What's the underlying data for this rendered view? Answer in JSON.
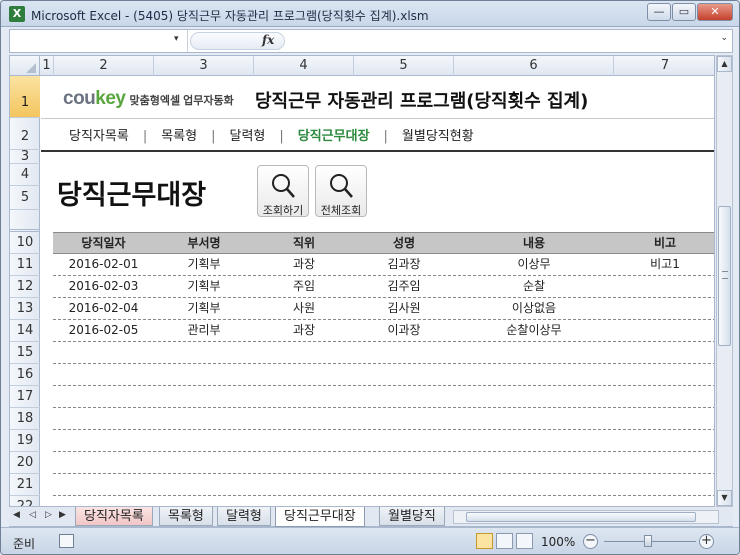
{
  "window": {
    "title": "Microsoft Excel - (5405) 당직근무 자동관리 프로그램(당직횟수 집계).xlsm",
    "app_icon": "X",
    "min_label": "—",
    "restore_label": "▭",
    "close_label": "✕"
  },
  "formula_bar": {
    "fx_label": "fx",
    "name_arrow": "▾",
    "expand_arrow": "⌄"
  },
  "columns": [
    "1",
    "2",
    "3",
    "4",
    "5",
    "6",
    "7"
  ],
  "rows": [
    "1",
    "2",
    "3",
    "4",
    "5",
    "10",
    "11",
    "12",
    "13",
    "14",
    "15",
    "16",
    "17",
    "18",
    "19",
    "20",
    "21",
    "22"
  ],
  "header": {
    "logo_main_1": "cou",
    "logo_main_2": "key",
    "logo_sub": "맞춤형엑셀 업무자동화",
    "app_title": "당직근무 자동관리 프로그램(당직횟수 집계)"
  },
  "nav": {
    "items": [
      "당직자목록",
      "목록형",
      "달력형",
      "당직근무대장",
      "월별당직현황"
    ],
    "separator": "|",
    "active_index": 3
  },
  "page_title": "당직근무대장",
  "buttons": {
    "search_label": "조회하기",
    "search_all_label": "전체조회"
  },
  "table": {
    "headers": [
      "당직일자",
      "부서명",
      "직위",
      "성명",
      "내용",
      "비고"
    ],
    "rows": [
      [
        "2016-02-01",
        "기획부",
        "과장",
        "김과장",
        "이상무",
        "비고1"
      ],
      [
        "2016-02-03",
        "기획부",
        "주임",
        "김주임",
        "순찰",
        ""
      ],
      [
        "2016-02-04",
        "기획부",
        "사원",
        "김사원",
        "이상없음",
        ""
      ],
      [
        "2016-02-05",
        "관리부",
        "과장",
        "이과장",
        "순찰이상무",
        ""
      ]
    ]
  },
  "sheet_tabs": [
    "당직자목록",
    "목록형",
    "달력형",
    "당직근무대장",
    "월별당직"
  ],
  "active_tab": 3,
  "status": {
    "ready": "준비",
    "zoom": "100%",
    "zoom_minus": "−",
    "zoom_plus": "+"
  },
  "colors": {
    "active_nav": "#2b8a3e",
    "logo_green": "#5aa63e",
    "table_header_bg": "#c6c6c6"
  }
}
